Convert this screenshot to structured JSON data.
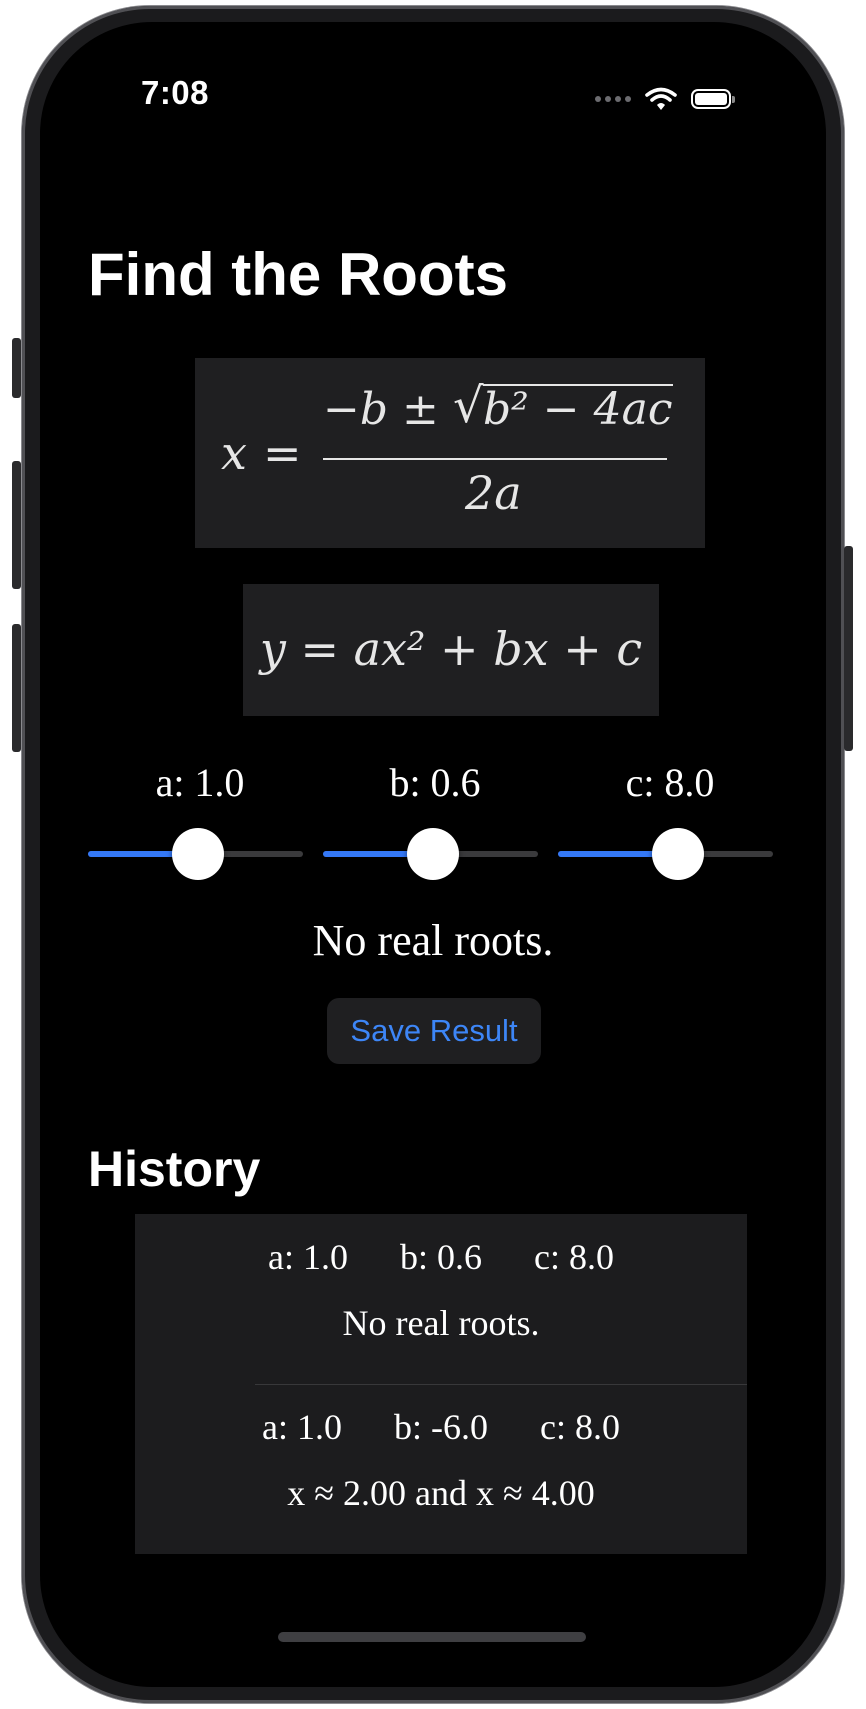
{
  "status_bar": {
    "time": "7:08"
  },
  "title": "Find the Roots",
  "formulas": {
    "quadratic_formula": {
      "lhs": "x",
      "eq": "=",
      "numerator_prefix": "−b ±",
      "radicand": "b² − 4ac",
      "denominator": "2a"
    },
    "equation": "y = ax² + bx + c"
  },
  "params": [
    {
      "label": "a: 1.0",
      "slider_fraction": 0.51
    },
    {
      "label": "b: 0.6",
      "slider_fraction": 0.51
    },
    {
      "label": "c: 8.0",
      "slider_fraction": 0.56
    }
  ],
  "result": "No real roots.",
  "save_button": "Save Result",
  "history": {
    "title": "History",
    "items": [
      {
        "a": "a: 1.0",
        "b": "b: 0.6",
        "c": "c: 8.0",
        "result": "No real roots."
      },
      {
        "a": "a: 1.0",
        "b": "b: -6.0",
        "c": "c: 8.0",
        "result": "x ≈ 2.00 and x ≈ 4.00"
      }
    ]
  },
  "colors": {
    "accent": "#3478f6",
    "button_text": "#3d86f7",
    "card_bg": "#1f1f21",
    "background": "#000000"
  }
}
